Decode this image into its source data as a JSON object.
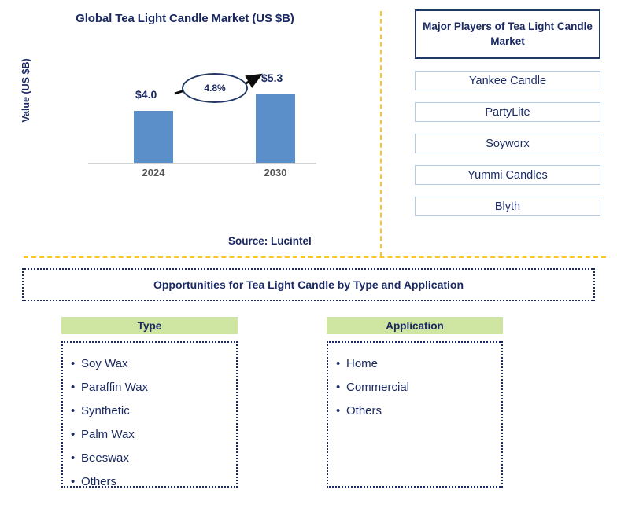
{
  "chart_data": {
    "type": "bar",
    "title": "Global Tea Light Candle Market (US $B)",
    "xlabel": "",
    "ylabel": "Value (US $B)",
    "categories": [
      "2024",
      "2030"
    ],
    "values": [
      4.0,
      5.3
    ],
    "value_labels": [
      "$4.0",
      "$5.3"
    ],
    "ylim": [
      0,
      6.5
    ],
    "grid": false,
    "legend": "none",
    "series": [
      {
        "name": "Value (US $B)",
        "values": [
          4.0,
          5.3
        ]
      }
    ],
    "annotations": [
      {
        "name": "cagr",
        "text": "4.8%",
        "shape": "ellipse",
        "from": "2024",
        "to": "2030"
      }
    ],
    "bar_color": "#5b8fc9",
    "axis_color": "#d2d2d2",
    "tick_label_color": "#555555",
    "text_color": "#1b2a63"
  },
  "chart_panel": {
    "title": "Global Tea Light Candle Market (US $B)",
    "y_axis_label": "Value (US $B)",
    "cagr_label": "4.8%",
    "bars": [
      {
        "label": "2024",
        "value_label": "$4.0"
      },
      {
        "label": "2030",
        "value_label": "$5.3"
      }
    ],
    "source": "Source: Lucintel"
  },
  "players_panel": {
    "header": "Major Players of Tea Light Candle Market",
    "items": [
      {
        "label": "Yankee Candle"
      },
      {
        "label": "PartyLite"
      },
      {
        "label": "Soyworx"
      },
      {
        "label": "Yummi Candles"
      },
      {
        "label": "Blyth"
      }
    ]
  },
  "opportunities": {
    "title": "Opportunities for Tea Light Candle by Type and Application",
    "columns": [
      {
        "heading": "Type",
        "items": [
          "Soy Wax",
          "Paraffin Wax",
          "Synthetic",
          "Palm Wax",
          "Beeswax",
          "Others"
        ]
      },
      {
        "heading": "Application",
        "items": [
          "Home",
          "Commercial",
          "Others"
        ]
      }
    ]
  },
  "colors": {
    "navy": "#1b2a63",
    "bar_blue": "#5b8fc9",
    "divider_orange": "#ffc425",
    "header_green": "#cfe6a3",
    "player_border": "#b5cbe4"
  },
  "bullet": "•"
}
